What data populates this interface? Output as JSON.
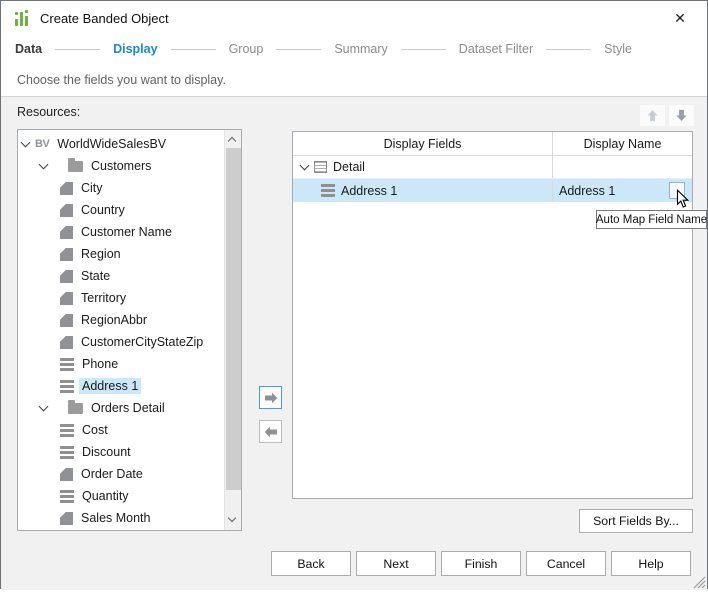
{
  "window": {
    "title": "Create Banded Object",
    "close_glyph": "✕"
  },
  "wizard": {
    "steps": [
      {
        "label": "Data",
        "state": "done"
      },
      {
        "label": "Display",
        "state": "active"
      },
      {
        "label": "Group",
        "state": "todo"
      },
      {
        "label": "Summary",
        "state": "todo"
      },
      {
        "label": "Dataset Filter",
        "state": "todo"
      },
      {
        "label": "Style",
        "state": "todo"
      }
    ]
  },
  "subtitle": "Choose the fields you want to display.",
  "resources": {
    "label": "Resources:",
    "bv_glyph": "BV",
    "tree": [
      {
        "label": "WorldWideSalesBV",
        "icon": "bv",
        "level": 0,
        "expanded": true
      },
      {
        "label": "Customers",
        "icon": "folder",
        "level": 1,
        "expanded": true
      },
      {
        "label": "City",
        "icon": "column",
        "level": 2
      },
      {
        "label": "Country",
        "icon": "column",
        "level": 2
      },
      {
        "label": "Customer Name",
        "icon": "column",
        "level": 2
      },
      {
        "label": "Region",
        "icon": "column",
        "level": 2
      },
      {
        "label": "State",
        "icon": "column",
        "level": 2
      },
      {
        "label": "Territory",
        "icon": "column",
        "level": 2
      },
      {
        "label": "RegionAbbr",
        "icon": "column",
        "level": 2
      },
      {
        "label": "CustomerCityStateZip",
        "icon": "column",
        "level": 2
      },
      {
        "label": "Phone",
        "icon": "lines",
        "level": 2
      },
      {
        "label": "Address 1",
        "icon": "lines",
        "level": 2,
        "selected": true
      },
      {
        "label": "Orders Detail",
        "icon": "folder",
        "level": 1,
        "expanded": true
      },
      {
        "label": "Cost",
        "icon": "lines",
        "level": 2
      },
      {
        "label": "Discount",
        "icon": "lines",
        "level": 2
      },
      {
        "label": "Order Date",
        "icon": "column",
        "level": 2
      },
      {
        "label": "Quantity",
        "icon": "lines",
        "level": 2
      },
      {
        "label": "Sales Month",
        "icon": "column",
        "level": 2
      }
    ]
  },
  "fields_table": {
    "columns": [
      "Display Fields",
      "Display Name"
    ],
    "rows": [
      {
        "field": "Detail",
        "icon": "table",
        "display_name": "",
        "group": true,
        "expanded": true
      },
      {
        "field": "Address 1",
        "icon": "lines",
        "display_name": "Address 1",
        "selected": true,
        "has_automap_button": true
      }
    ],
    "tooltip": "Auto Map Field Name"
  },
  "buttons": {
    "sort": "Sort Fields By...",
    "back": "Back",
    "next": "Next",
    "finish": "Finish",
    "cancel": "Cancel",
    "help": "Help"
  },
  "colors": {
    "accent": "#1787d8",
    "selection": "#cbe8f8",
    "icon_green": "#6cb33f"
  }
}
